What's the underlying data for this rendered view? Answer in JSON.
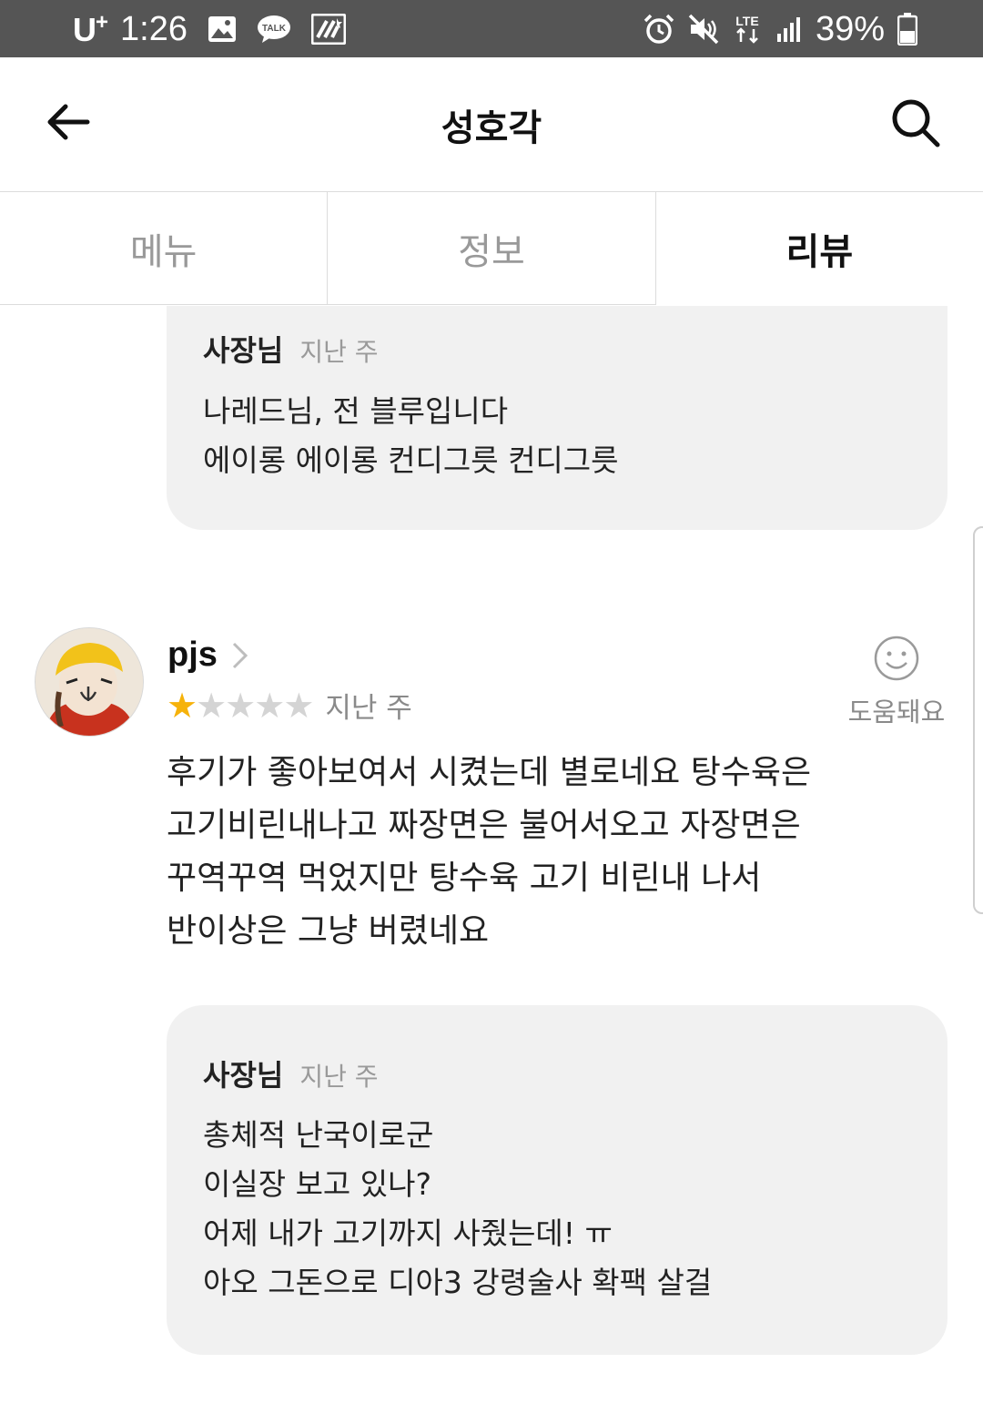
{
  "status_bar": {
    "carrier": "U",
    "carrier_plus": "+",
    "time": "1:26",
    "talk_label": "TALK",
    "network": "LTE",
    "battery": "39%",
    "icons": [
      "image-icon",
      "talk-icon",
      "charging-app-icon",
      "alarm-icon",
      "mute-icon",
      "lte-icon",
      "signal-icon",
      "battery-icon"
    ]
  },
  "header": {
    "title": "성호각",
    "back_icon": "back-arrow-icon",
    "search_icon": "search-icon"
  },
  "tabs": [
    {
      "label": "메뉴",
      "active": false
    },
    {
      "label": "정보",
      "active": false
    },
    {
      "label": "리뷰",
      "active": true
    }
  ],
  "reply_top": {
    "author": "사장님",
    "time": "지난 주",
    "text": "나레드님, 전 블루입니다\n에이롱 에이롱 컨디그릇 컨디그릇"
  },
  "review": {
    "author": "pjs",
    "rating": 1,
    "rating_max": 5,
    "time": "지난 주",
    "helpful_label": "도움돼요",
    "text": "후기가 좋아보여서 시켰는데 별로네요 탕수육은\n고기비린내나고 짜장면은 불어서오고 자장면은\n꾸역꾸역 먹었지만 탕수육 고기 비린내 나서\n반이상은 그냥 버렸네요",
    "reply": {
      "author": "사장님",
      "time": "지난 주",
      "text": "총체적 난국이로군\n이실장 보고 있나?\n어제 내가 고기까지 사줬는데! ㅠ\n아오 그돈으로 디아3 강령술사 확팩 살걸"
    }
  },
  "colors": {
    "status_bar_bg": "#555555",
    "star_active": "#f6b20a",
    "star_inactive": "#d4d4d4",
    "reply_bg": "#f1f1f1"
  }
}
